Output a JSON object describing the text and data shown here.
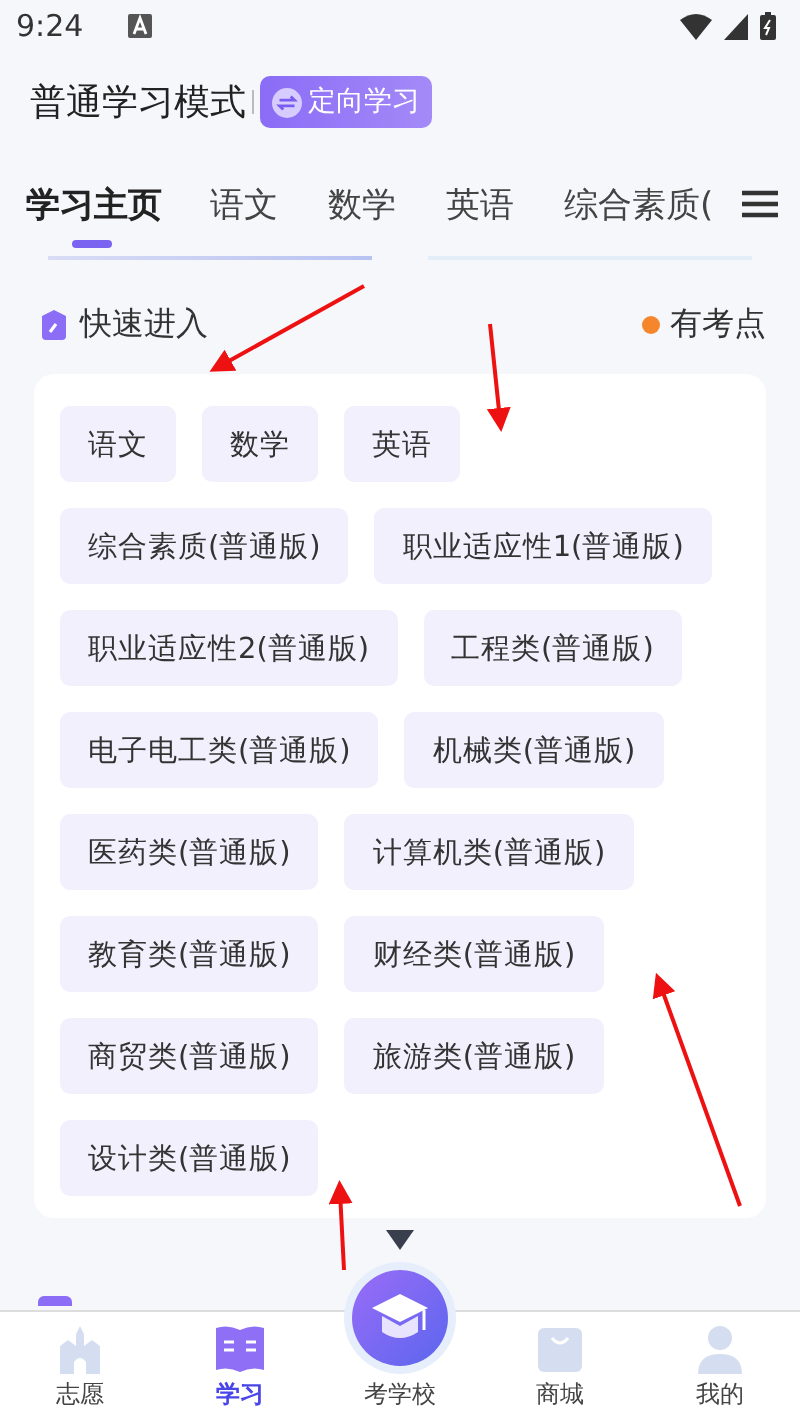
{
  "status_bar": {
    "time": "9:24"
  },
  "header": {
    "title": "普通学习模式",
    "mode_button": "定向学习"
  },
  "tabs": [
    {
      "label": "学习主页",
      "selected": true
    },
    {
      "label": "语文",
      "selected": false
    },
    {
      "label": "数学",
      "selected": false
    },
    {
      "label": "英语",
      "selected": false
    },
    {
      "label": "综合素质(",
      "selected": false
    }
  ],
  "quick_entry": {
    "title": "快速进入",
    "legend": "有考点",
    "chips": [
      "语文",
      "数学",
      "英语",
      "综合素质(普通版)",
      "职业适应性1(普通版)",
      "职业适应性2(普通版)",
      "工程类(普通版)",
      "电子电工类(普通版)",
      "机械类(普通版)",
      "医药类(普通版)",
      "计算机类(普通版)",
      "教育类(普通版)",
      "财经类(普通版)",
      "商贸类(普通版)",
      "旅游类(普通版)",
      "设计类(普通版)"
    ]
  },
  "bottom_nav": [
    {
      "label": "志愿",
      "kind": "tab",
      "selected": false
    },
    {
      "label": "学习",
      "kind": "tab",
      "selected": true
    },
    {
      "label": "考学校",
      "kind": "center",
      "selected": false
    },
    {
      "label": "商城",
      "kind": "tab",
      "selected": false
    },
    {
      "label": "我的",
      "kind": "tab",
      "selected": false
    }
  ]
}
